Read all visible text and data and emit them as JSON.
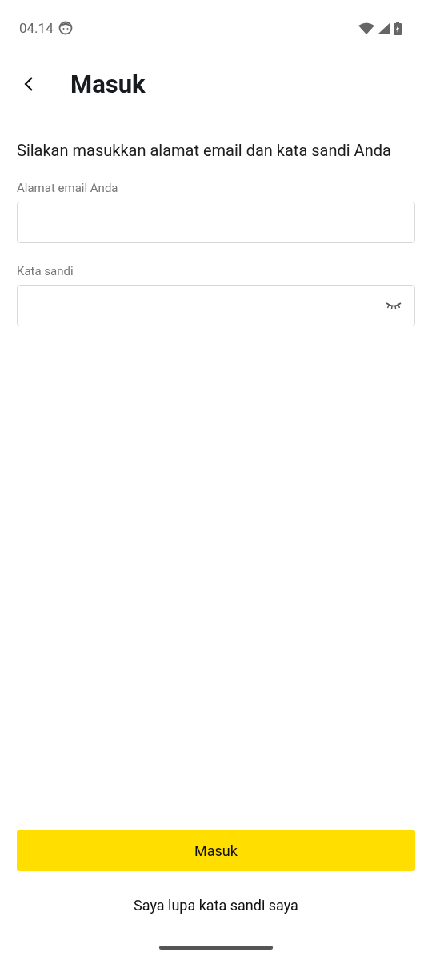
{
  "status_bar": {
    "time": "04.14"
  },
  "header": {
    "title": "Masuk"
  },
  "instruction": "Silakan masukkan alamat email dan kata sandi Anda",
  "fields": [
    {
      "kind": "email",
      "label": "Alamat email Anda"
    },
    {
      "kind": "password",
      "label": "Kata sandi"
    }
  ],
  "submit_button": "Masuk",
  "forgot_link": "Saya lupa kata sandi saya"
}
